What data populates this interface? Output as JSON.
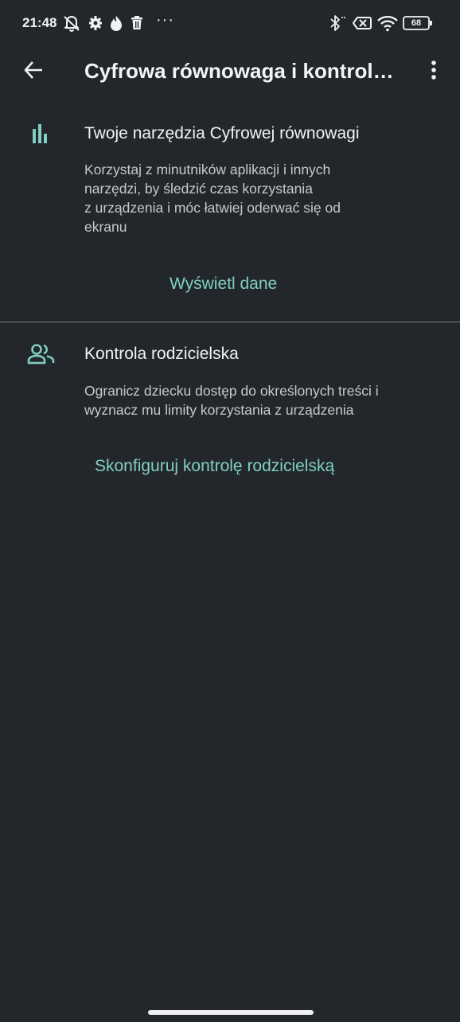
{
  "status_bar": {
    "time": "21:48",
    "icons": [
      "mute-icon",
      "settings-icon",
      "fire-icon",
      "trash-icon",
      "more-notifications-icon",
      "bluetooth-icon",
      "no-sim-icon",
      "wifi-icon",
      "battery-icon"
    ],
    "more": "···",
    "battery_level": "68"
  },
  "app_bar": {
    "title": "Cyfrowa równowaga i kontrola rodzicielska",
    "back_icon": "arrow-back-icon",
    "menu_icon": "more-vert-icon"
  },
  "sections": [
    {
      "icon": "bar-chart-icon",
      "title": "Twoje narzędzia Cyfrowej równowagi",
      "description_lines": [
        "Korzystaj z minutników aplikacji i innych",
        "narzędzi, by śledzić czas korzystania",
        "z urządzenia i móc łatwiej oderwać się od",
        "ekranu"
      ],
      "action": "Wyświetl dane"
    },
    {
      "icon": "people-icon",
      "title": "Kontrola rodzicielska",
      "description_lines": [
        "Ogranicz dziecku dostęp do określonych treści i",
        "wyznacz mu limity korzystania z urządzenia"
      ],
      "action": "Skonfiguruj kontrolę rodzicielską"
    }
  ],
  "colors": {
    "background": "#23272c",
    "accent": "#7fcfc4",
    "divider": "#7a7d80"
  }
}
